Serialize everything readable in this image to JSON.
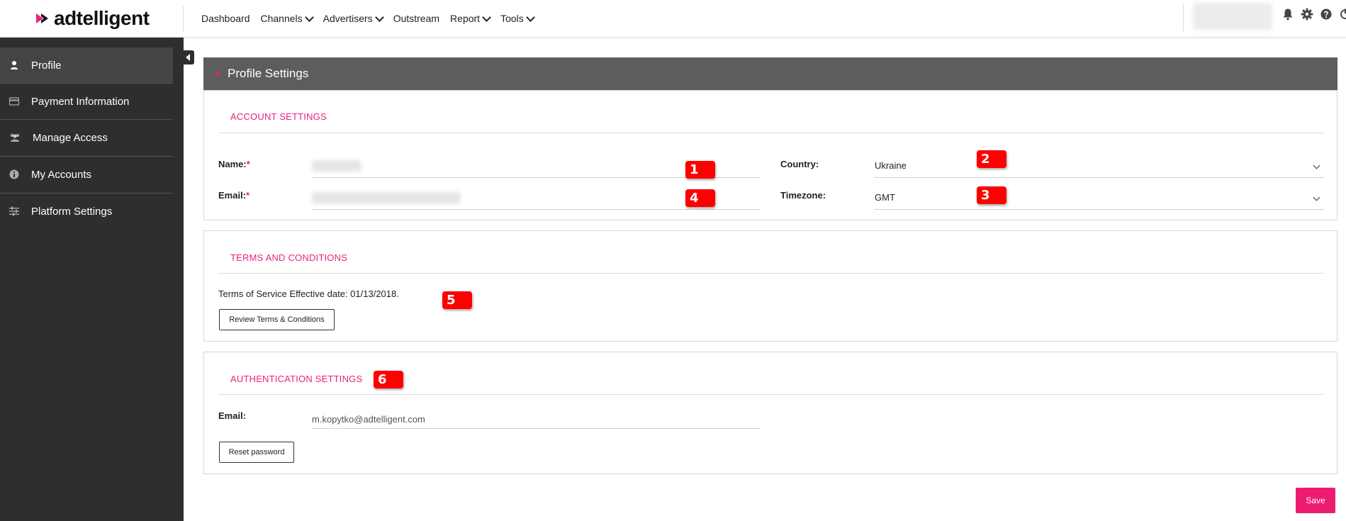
{
  "brand": {
    "logo_text": "adtelligent",
    "accent": "#e6237e"
  },
  "nav": {
    "items": [
      {
        "label": "Dashboard",
        "has_dropdown": false
      },
      {
        "label": "Channels",
        "has_dropdown": true
      },
      {
        "label": "Advertisers",
        "has_dropdown": true
      },
      {
        "label": "Outstream",
        "has_dropdown": false
      },
      {
        "label": "Report",
        "has_dropdown": true
      },
      {
        "label": "Tools",
        "has_dropdown": true
      }
    ],
    "icons": [
      "bell-icon",
      "gear-icon",
      "help-icon",
      "logout-icon"
    ]
  },
  "sidebar": {
    "items": [
      {
        "label": "Profile",
        "icon": "user-icon",
        "active": true
      },
      {
        "label": "Payment Information",
        "icon": "credit-card-icon",
        "active": false
      },
      {
        "label": "Manage Access",
        "icon": "users-icon",
        "active": false
      },
      {
        "label": "My Accounts",
        "icon": "info-icon",
        "active": false
      },
      {
        "label": "Platform Settings",
        "icon": "sliders-icon",
        "active": false
      }
    ]
  },
  "panel": {
    "title": "Profile Settings"
  },
  "account_settings": {
    "title": "ACCOUNT SETTINGS",
    "name_label": "Name:",
    "email_label": "Email:",
    "required_mark": "*",
    "country_label": "Country:",
    "country_value": "Ukraine",
    "timezone_label": "Timezone:",
    "timezone_value": "GMT"
  },
  "terms": {
    "title": "TERMS AND CONDITIONS",
    "text": "Terms of Service Effective date: 01/13/2018.",
    "button": "Review Terms & Conditions"
  },
  "auth": {
    "title": "AUTHENTICATION SETTINGS",
    "email_label": "Email:",
    "email_value": "m.kopytko@adtelligent.com",
    "button": "Reset password"
  },
  "badges": [
    "1",
    "2",
    "3",
    "4",
    "5",
    "6"
  ],
  "save_label": "Save"
}
